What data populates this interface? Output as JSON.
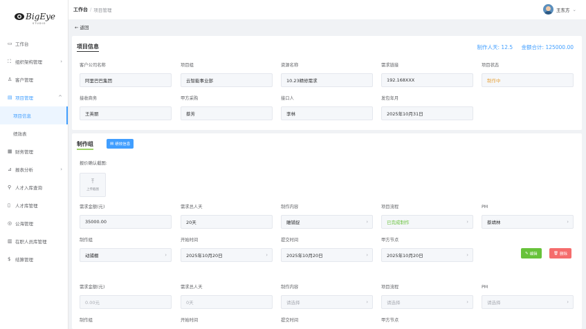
{
  "brand": {
    "logo_text": "BigEyes",
    "logo_sub": "STUDIO"
  },
  "sidebar": {
    "items": [
      {
        "icon": "monitor-icon",
        "label": "工作台",
        "arrow": ""
      },
      {
        "icon": "org-icon",
        "label": "组织架构管理",
        "arrow": "›"
      },
      {
        "icon": "user-icon",
        "label": "客户管理",
        "arrow": ""
      },
      {
        "icon": "project-icon",
        "label": "项目管理",
        "arrow": "^"
      },
      {
        "label": "项目信息"
      },
      {
        "label": "绩效表"
      },
      {
        "icon": "finance-icon",
        "label": "财务管理",
        "arrow": ""
      },
      {
        "icon": "report-icon",
        "label": "报表分析",
        "arrow": "›"
      },
      {
        "icon": "search-icon",
        "label": "人才入库查询",
        "arrow": ""
      },
      {
        "icon": "document-icon",
        "label": "人才库管理",
        "arrow": ""
      },
      {
        "icon": "ocean-icon",
        "label": "公海管理",
        "arrow": ""
      },
      {
        "icon": "staff-icon",
        "label": "在职人员库管理",
        "arrow": ""
      },
      {
        "icon": "dollar-icon",
        "label": "结算管理",
        "arrow": ""
      }
    ]
  },
  "header": {
    "breadcrumb_root": "工作台",
    "breadcrumb_sep": "/",
    "breadcrumb_current": "项目管理",
    "user_name": "王东方",
    "user_chevron": "⌄"
  },
  "back": {
    "label": "← 返回"
  },
  "info": {
    "title": "项目信息",
    "days_label": "制作人天: 12.5",
    "amount_label": "金额合计: 125000.00",
    "fields": [
      {
        "label": "客户公司名称",
        "value": "阿里巴巴集团"
      },
      {
        "label": "项目组",
        "value": "云智能事业部"
      },
      {
        "label": "资源名称",
        "value": "10.23精修需求"
      },
      {
        "label": "需求链接",
        "value": "192.168XXX"
      },
      {
        "label": "项目状态",
        "value": "制作中"
      },
      {
        "label": "接收商务",
        "value": "王英丽"
      },
      {
        "label": "甲方采购",
        "value": "蔡芳"
      },
      {
        "label": "接口人",
        "value": "李林"
      },
      {
        "label": "发包年月",
        "value": "2025年10月31日"
      }
    ]
  },
  "production": {
    "title": "制作组",
    "perf_button": "绩效信息",
    "quote_label": "报价确认截图:",
    "upload_label": "上传截图",
    "rows": [
      {
        "fields": [
          {
            "label": "需求金额(元)",
            "value": "35000.00"
          },
          {
            "label": "需求总人天",
            "value": "20天"
          },
          {
            "label": "制作内容",
            "value": "雕铺捉"
          },
          {
            "label": "项目流程",
            "value": "已完成制作"
          },
          {
            "label": "PM",
            "value": "蔡靖林"
          },
          {
            "label": "制作组",
            "value": "动捕棚"
          },
          {
            "label": "开始时间",
            "value": "2025年10月20日"
          },
          {
            "label": "提交时间",
            "value": "2025年10月20日"
          },
          {
            "label": "甲方节点",
            "value": "2025年10月20日"
          }
        ]
      },
      {
        "fields": [
          {
            "label": "需求金额(元)",
            "value": "0.00元"
          },
          {
            "label": "需求总人天",
            "value": "0天"
          },
          {
            "label": "制作内容",
            "value": "请选择"
          },
          {
            "label": "项目流程",
            "value": "请选择"
          },
          {
            "label": "PM",
            "value": "请选择"
          },
          {
            "label": "制作组",
            "value": ""
          },
          {
            "label": "开始时间",
            "value": ""
          },
          {
            "label": "提交时间",
            "value": ""
          },
          {
            "label": "甲方节点",
            "value": ""
          }
        ]
      }
    ],
    "edit_button": "编辑",
    "delete_button": "删除"
  },
  "chevron": "›",
  "colors": {
    "accent": "#409eff",
    "success": "#67c23a",
    "danger": "#f56c6c",
    "warning": "#e6a23c"
  }
}
